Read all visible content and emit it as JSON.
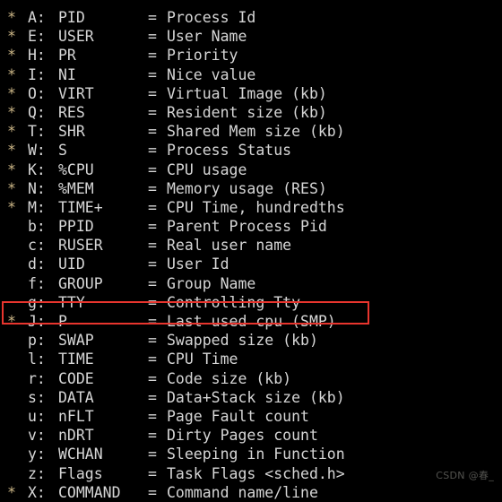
{
  "terminal": {
    "background_color": "#000000",
    "text_color": "#d6d6d6",
    "star_color": "#cdb888",
    "highlight_color": "#e8352e",
    "equals_sign": "=",
    "rows": [
      {
        "star": "*",
        "key": "A:",
        "name": "PID",
        "desc": "Process Id"
      },
      {
        "star": "*",
        "key": "E:",
        "name": "USER",
        "desc": "User Name"
      },
      {
        "star": "*",
        "key": "H:",
        "name": "PR",
        "desc": "Priority"
      },
      {
        "star": "*",
        "key": "I:",
        "name": "NI",
        "desc": "Nice value"
      },
      {
        "star": "*",
        "key": "O:",
        "name": "VIRT",
        "desc": "Virtual Image (kb)"
      },
      {
        "star": "*",
        "key": "Q:",
        "name": "RES",
        "desc": "Resident size (kb)"
      },
      {
        "star": "*",
        "key": "T:",
        "name": "SHR",
        "desc": "Shared Mem size (kb)"
      },
      {
        "star": "*",
        "key": "W:",
        "name": "S",
        "desc": "Process Status"
      },
      {
        "star": "*",
        "key": "K:",
        "name": "%CPU",
        "desc": "CPU usage"
      },
      {
        "star": "*",
        "key": "N:",
        "name": "%MEM",
        "desc": "Memory usage (RES)"
      },
      {
        "star": "*",
        "key": "M:",
        "name": "TIME+",
        "desc": "CPU Time, hundredths"
      },
      {
        "star": "",
        "key": "b:",
        "name": "PPID",
        "desc": "Parent Process Pid"
      },
      {
        "star": "",
        "key": "c:",
        "name": "RUSER",
        "desc": "Real user name"
      },
      {
        "star": "",
        "key": "d:",
        "name": "UID",
        "desc": "User Id"
      },
      {
        "star": "",
        "key": "f:",
        "name": "GROUP",
        "desc": "Group Name"
      },
      {
        "star": "",
        "key": "g:",
        "name": "TTY",
        "desc": "Controlling Tty"
      },
      {
        "star": "*",
        "key": "J:",
        "name": "P",
        "desc": "Last used cpu (SMP)"
      },
      {
        "star": "",
        "key": "p:",
        "name": "SWAP",
        "desc": "Swapped size (kb)"
      },
      {
        "star": "",
        "key": "l:",
        "name": "TIME",
        "desc": "CPU Time"
      },
      {
        "star": "",
        "key": "r:",
        "name": "CODE",
        "desc": "Code size (kb)"
      },
      {
        "star": "",
        "key": "s:",
        "name": "DATA",
        "desc": "Data+Stack size (kb)"
      },
      {
        "star": "",
        "key": "u:",
        "name": "nFLT",
        "desc": "Page Fault count"
      },
      {
        "star": "",
        "key": "v:",
        "name": "nDRT",
        "desc": "Dirty Pages count"
      },
      {
        "star": "",
        "key": "y:",
        "name": "WCHAN",
        "desc": "Sleeping in Function"
      },
      {
        "star": "",
        "key": "z:",
        "name": "Flags",
        "desc": "Task Flags <sched.h>"
      },
      {
        "star": "*",
        "key": "X:",
        "name": "COMMAND",
        "desc": "Command name/line"
      }
    ],
    "highlighted_row_index": 16
  },
  "watermark": {
    "text": "CSDN @春_"
  }
}
